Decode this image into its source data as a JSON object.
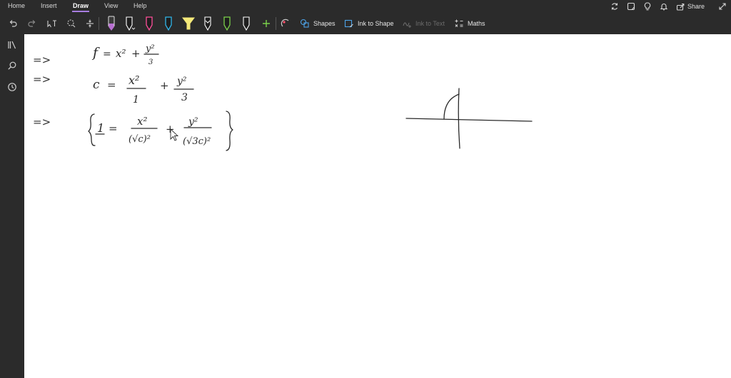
{
  "menu": {
    "items": [
      "Home",
      "Insert",
      "Draw",
      "View",
      "Help"
    ],
    "active": "Draw"
  },
  "header": {
    "share_label": "Share",
    "icons": [
      "sync-icon",
      "notebook-icon",
      "lightbulb-icon",
      "bell-icon",
      "share-icon",
      "expand-icon"
    ]
  },
  "toolbar": {
    "shapes_label": "Shapes",
    "ink_to_shape_label": "Ink to Shape",
    "ink_to_text_label": "Ink to Text",
    "maths_label": "Maths",
    "pens": [
      {
        "name": "pen-purple",
        "color": "#b86fd1"
      },
      {
        "name": "pen-black-selected",
        "color": "#ffffff"
      },
      {
        "name": "pen-pink",
        "color": "#ff4f9a"
      },
      {
        "name": "pen-cyan",
        "color": "#2fb6ea"
      },
      {
        "name": "highlighter-yellow",
        "color": "#f5ea7a"
      },
      {
        "name": "pen-black",
        "color": "#ffffff"
      },
      {
        "name": "pen-green",
        "color": "#7bd14a"
      },
      {
        "name": "pen-white",
        "color": "#ffffff"
      }
    ],
    "accent": "#a77de0"
  },
  "sidebar": {
    "icons": [
      "notebooks-icon",
      "search-icon",
      "recent-icon"
    ]
  },
  "canvas": {
    "lines": [
      {
        "arrow": "=>",
        "lhs": "f",
        "eq": "=",
        "term1": "x²",
        "plus": "+",
        "num": "y²",
        "den": "3"
      },
      {
        "arrow": "=>",
        "lhs": "c",
        "eq": "=",
        "num1": "x²",
        "den1": "1",
        "plus": "+",
        "num2": "y²",
        "den2": "3"
      },
      {
        "arrow": "=>",
        "lhs": "1",
        "eq": "=",
        "num1": "x²",
        "den1": "(√c)²",
        "plus": "+",
        "num2": "y²",
        "den2": "(√3c)²"
      }
    ]
  }
}
